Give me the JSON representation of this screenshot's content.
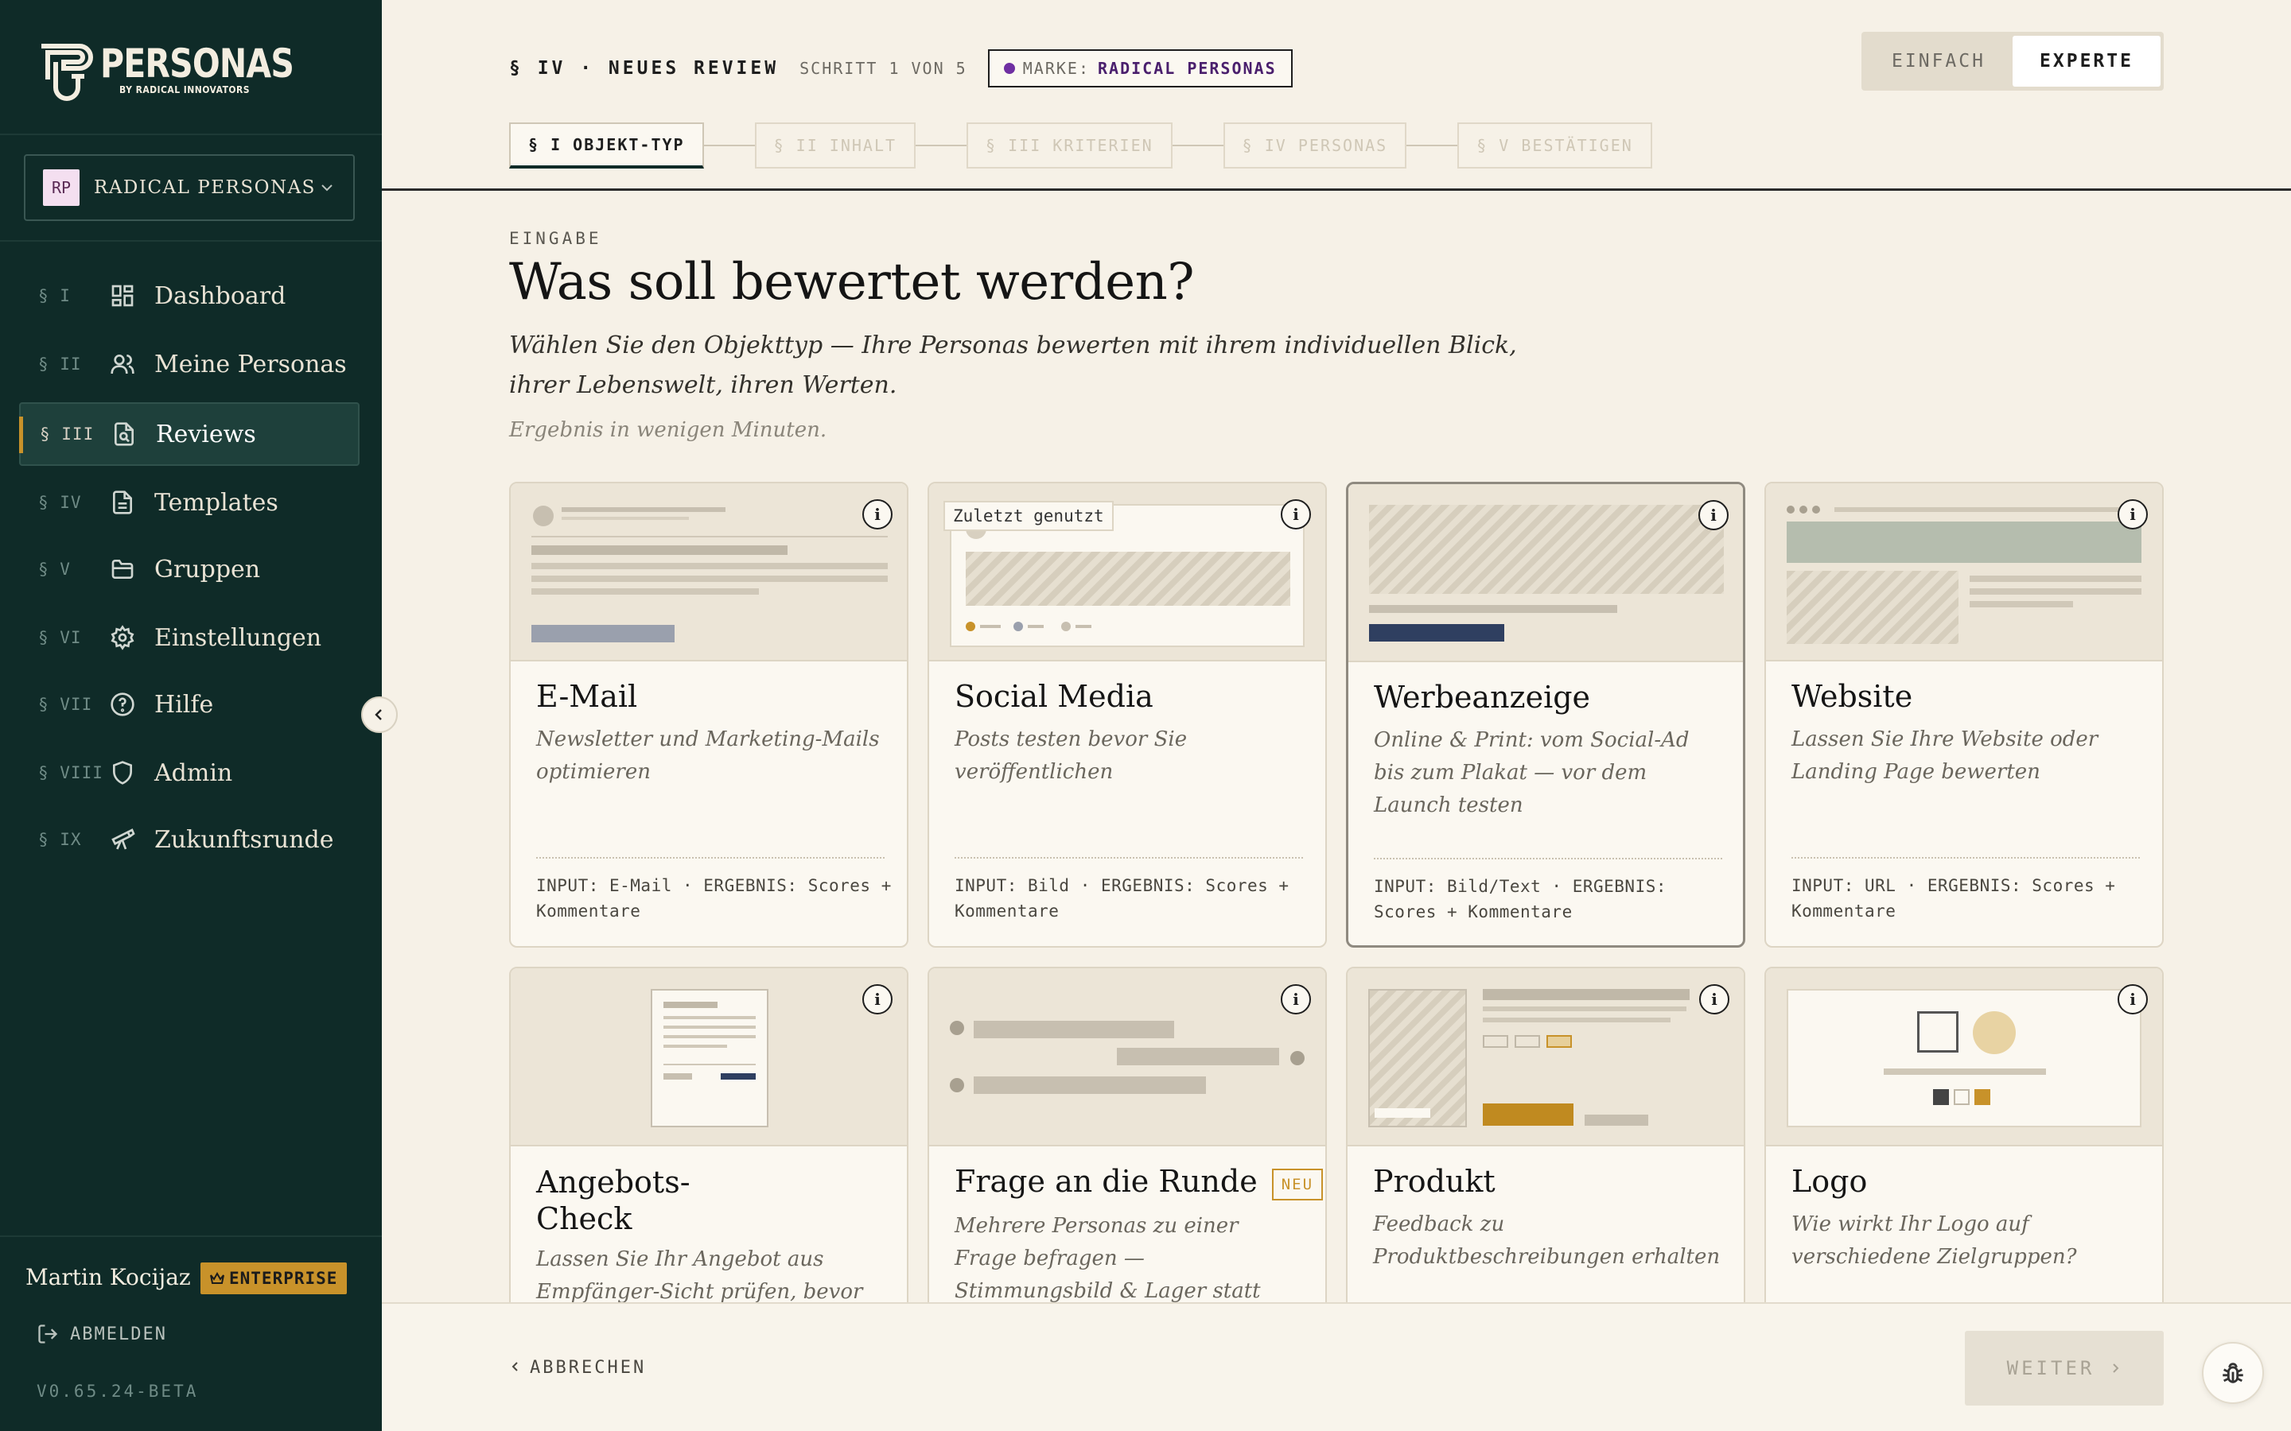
{
  "sidebar": {
    "logo_word": "PERSONAS",
    "logo_sub": "BY RADICAL INNOVATORS",
    "brand": {
      "initials": "RP",
      "name": "RADICAL PERSONAS"
    },
    "items": [
      {
        "num": "§ I",
        "label": "Dashboard",
        "icon": "grid-icon"
      },
      {
        "num": "§ II",
        "label": "Meine Personas",
        "icon": "users-icon"
      },
      {
        "num": "§ III",
        "label": "Reviews",
        "icon": "file-search-icon",
        "active": true
      },
      {
        "num": "§ IV",
        "label": "Templates",
        "icon": "document-icon"
      },
      {
        "num": "§ V",
        "label": "Gruppen",
        "icon": "folder-icon"
      },
      {
        "num": "§ VI",
        "label": "Einstellungen",
        "icon": "gear-icon"
      },
      {
        "num": "§ VII",
        "label": "Hilfe",
        "icon": "help-circle-icon"
      },
      {
        "num": "§ VIII",
        "label": "Admin",
        "icon": "shield-icon"
      },
      {
        "num": "§ IX",
        "label": "Zukunftsrunde",
        "icon": "telescope-icon"
      }
    ],
    "user": {
      "name": "Martin Kocijaz",
      "plan": "ENTERPRISE"
    },
    "logout": "ABMELDEN",
    "version": "V0.65.24-BETA"
  },
  "header": {
    "title": "§ IV · NEUES REVIEW",
    "step": "SCHRITT 1 VON 5",
    "brand_label": "MARKE:",
    "brand_value": "RADICAL PERSONAS",
    "mode": {
      "simple": "EINFACH",
      "expert": "EXPERTE",
      "selected": "expert"
    },
    "steps": [
      "§ I OBJEKT-TYP",
      "§ II INHALT",
      "§ III KRITERIEN",
      "§ IV PERSONAS",
      "§ V BESTÄTIGEN"
    ]
  },
  "main": {
    "eyebrow": "EINGABE",
    "title": "Was soll bewertet werden?",
    "lead": "Wählen Sie den Objekttyp — Ihre Personas bewerten mit ihrem individuellen Blick, ihrer Lebenswelt, ihren Werten.",
    "hint": "Ergebnis in wenigen Minuten.",
    "cards": [
      {
        "title": "E-Mail",
        "desc": "Newsletter und Marketing-Mails optimieren",
        "meta": "INPUT: E-Mail · ERGEBNIS: Scores + Kommentare"
      },
      {
        "title": "Social Media",
        "desc": "Posts testen bevor Sie veröffentlichen",
        "meta": "INPUT: Bild · ERGEBNIS: Scores + Kommentare",
        "badge": "Zuletzt genutzt"
      },
      {
        "title": "Werbeanzeige",
        "desc": "Online & Print: vom Social-Ad bis zum Plakat — vor dem Launch testen",
        "meta": "INPUT: Bild/Text · ERGEBNIS: Scores + Kommentare",
        "selected": true
      },
      {
        "title": "Website",
        "desc": "Lassen Sie Ihre Website oder Landing Page bewerten",
        "meta": "INPUT: URL · ERGEBNIS: Scores + Kommentare"
      },
      {
        "title": "Angebots-Check",
        "desc": "Lassen Sie Ihr Angebot aus Empfänger-Sicht prüfen, bevor es"
      },
      {
        "title": "Frage an die Runde",
        "desc": "Mehrere Personas zu einer Frage befragen — Stimmungsbild & Lager statt Score",
        "tag": "NEU"
      },
      {
        "title": "Produkt",
        "desc": "Feedback zu Produktbeschreibungen erhalten"
      },
      {
        "title": "Logo",
        "desc": "Wie wirkt Ihr Logo auf verschiedene Zielgruppen?"
      }
    ]
  },
  "footer": {
    "cancel": "ABBRECHEN",
    "next": "WEITER"
  },
  "colors": {
    "sidebar": "#0f2b28",
    "accent": "#c8922a",
    "background": "#f6f1e7",
    "brand_dot": "#6f2fa2"
  }
}
